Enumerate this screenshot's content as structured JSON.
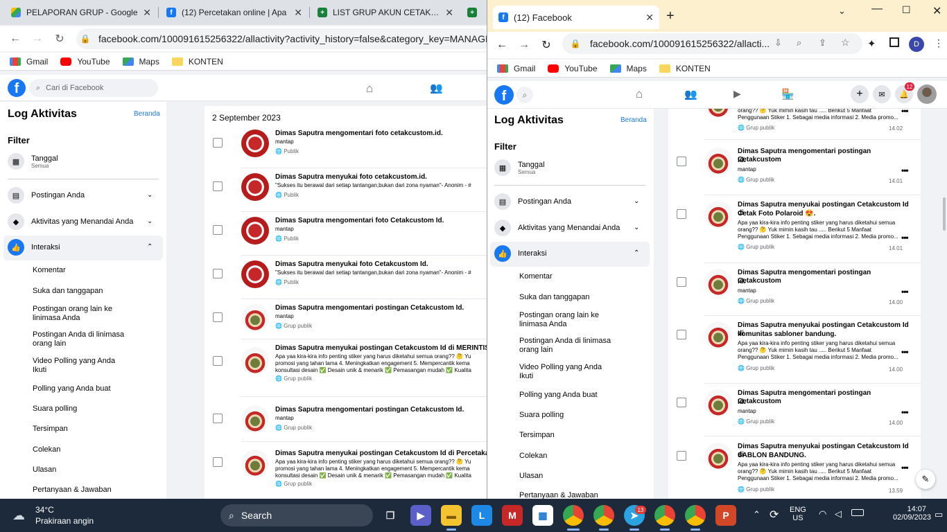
{
  "left_window": {
    "tabs": [
      {
        "title": "PELAPORAN GRUP - Google"
      },
      {
        "title": "(12) Percetakan online | Apa"
      },
      {
        "title": "LIST GRUP AKUN CETAK CUS"
      }
    ],
    "url": "facebook.com/100091615256322/allactivity?activity_history=false&category_key=MANAGE",
    "bookmarks": [
      "Gmail",
      "YouTube",
      "Maps",
      "KONTEN"
    ],
    "search_placeholder": "Cari di Facebook",
    "sidebar": {
      "title": "Log Aktivitas",
      "home": "Beranda",
      "filter": "Filter",
      "date_label": "Tanggal",
      "date_sub": "Semua",
      "sections": [
        "Postingan Anda",
        "Aktivitas yang Menandai Anda",
        "Interaksi"
      ],
      "items": [
        "Komentar",
        "Suka dan tanggapan",
        "Postingan orang lain ke linimasa Anda",
        "Postingan Anda di linimasa orang lain",
        "Video Polling yang Anda Ikuti",
        "Polling yang Anda buat",
        "Suara polling",
        "Tersimpan",
        "Colekan",
        "Ulasan",
        "Pertanyaan & Jawaban"
      ]
    },
    "date_header": "2 September 2023",
    "activities": [
      {
        "title": "Dimas Saputra mengomentari foto cetakcustom.id.",
        "body": [
          "mantap"
        ],
        "privacy": "Publik"
      },
      {
        "title": "Dimas Saputra menyukai foto cetakcustom.id.",
        "body": [
          "\"Sukses itu berawal dari setiap tantangan,bukan dari zona nyaman\"- Anonim - #"
        ],
        "privacy": "Publik"
      },
      {
        "title": "Dimas Saputra mengomentari foto Cetakcustom Id.",
        "body": [
          "mantap"
        ],
        "privacy": "Publik"
      },
      {
        "title": "Dimas Saputra menyukai foto Cetakcustom Id.",
        "body": [
          "\"Sukses itu berawal dari setiap tantangan,bukan dari zona nyaman\"- Anonim - #"
        ],
        "privacy": "Publik"
      },
      {
        "title": "Dimas Saputra mengomentari postingan Cetakcustom Id.",
        "body": [
          "mantap"
        ],
        "privacy": "Grup publik"
      },
      {
        "title": "Dimas Saputra menyukai postingan Cetakcustom Id di MERINTIS US",
        "body": [
          "Apa yaa kira-kira info penting stiker yang harus diketahui semua orang?? 🤔 Yu",
          "promosi yang tahan lama 4. Meningkatkan engagement 5. Mempercantik kema",
          "konsultasi desain ✅ Desain unik & menarik ✅ Pemasangan mudah ✅ Kualita"
        ],
        "privacy": "Grup publik"
      },
      {
        "title": "Dimas Saputra mengomentari postingan Cetakcustom Id.",
        "body": [
          "mantap"
        ],
        "privacy": "Grup publik"
      },
      {
        "title": "Dimas Saputra menyukai postingan Cetakcustom Id di Percetakan U",
        "body": [
          "Apa yaa kira-kira info penting stiker yang harus diketahui semua orang?? 🤔 Yu",
          "promosi yang tahan lama 4. Meningkatkan engagement 5. Mempercantik kema",
          "konsultasi desain ✅ Desain unik & menarik ✅ Pemasangan mudah ✅ Kualita"
        ],
        "privacy": "Grup publik"
      }
    ]
  },
  "right_window": {
    "tab_title": "(12) Facebook",
    "url": "facebook.com/100091615256322/allacti...",
    "profile_initial": "D",
    "notification_count": "12",
    "bookmarks": [
      "Gmail",
      "YouTube",
      "Maps",
      "KONTEN"
    ],
    "sidebar": {
      "title": "Log Aktivitas",
      "home": "Beranda",
      "filter": "Filter",
      "date_label": "Tanggal",
      "date_sub": "Semua",
      "sections": [
        "Postingan Anda",
        "Aktivitas yang Menandai Anda",
        "Interaksi"
      ],
      "items": [
        "Komentar",
        "Suka dan tanggapan",
        "Postingan orang lain ke linimasa Anda",
        "Postingan Anda di linimasa orang lain",
        "Video Polling yang Anda Ikuti",
        "Polling yang Anda buat",
        "Suara polling",
        "Tersimpan",
        "Colekan",
        "Ulasan",
        "Pertanyaan & Jawaban"
      ]
    },
    "top_partial": {
      "body": [
        "orang?? 🤔 Yuk mimin kasih tau ..... Berikut 5 Manfaat",
        "Penggunaan Stiker 1. Sebagai media informasi 2. Media promo..."
      ],
      "privacy": "Grup publik",
      "time": "14.02"
    },
    "activities": [
      {
        "title": [
          "Dimas Saputra mengomentari postingan Cetakcustom",
          "Id."
        ],
        "body": [
          "mantap"
        ],
        "privacy": "Grup publik",
        "time": "14.01"
      },
      {
        "title": [
          "Dimas Saputra menyukai postingan Cetakcustom Id di",
          "Cetak Foto Polaroid 😍."
        ],
        "body": [
          "Apa yaa kira-kira info penting stiker yang harus diketahui semua",
          "orang?? 🤔 Yuk mimin kasih tau ..... Berikut 5 Manfaat",
          "Penggunaan Stiker 1. Sebagai media informasi 2. Media promo..."
        ],
        "privacy": "Grup publik",
        "time": "14.01"
      },
      {
        "title": [
          "Dimas Saputra mengomentari postingan Cetakcustom",
          "Id."
        ],
        "body": [
          "mantap"
        ],
        "privacy": "Grup publik",
        "time": "14.00"
      },
      {
        "title": [
          "Dimas Saputra menyukai postingan Cetakcustom Id di",
          "komunitas sabloner bandung."
        ],
        "body": [
          "Apa yaa kira-kira info penting stiker yang harus diketahui semua",
          "orang?? 🤔 Yuk mimin kasih tau ..... Berikut 5 Manfaat",
          "Penggunaan Stiker 1. Sebagai media informasi 2. Media promo..."
        ],
        "privacy": "Grup publik",
        "time": "14.00"
      },
      {
        "title": [
          "Dimas Saputra mengomentari postingan Cetakcustom",
          "Id."
        ],
        "body": [
          "mantap"
        ],
        "privacy": "Grup publik",
        "time": "14.00"
      },
      {
        "title": [
          "Dimas Saputra menyukai postingan Cetakcustom Id di",
          "SABLON BANDUNG."
        ],
        "body": [
          "Apa yaa kira-kira info penting stiker yang harus diketahui semua",
          "orang?? 🤔 Yuk mimin kasih tau ..... Berikut 5 Manfaat",
          "Penggunaan Stiker 1. Sebagai media informasi 2. Media promo..."
        ],
        "privacy": "Grup publik",
        "time": "13.59"
      }
    ]
  },
  "taskbar": {
    "weather_temp": "34°C",
    "weather_desc": "Prakiraan angin",
    "search": "Search",
    "lang": "ENG",
    "region": "US",
    "time": "14:07",
    "date": "02/09/2023",
    "telegram_badge": "13"
  }
}
